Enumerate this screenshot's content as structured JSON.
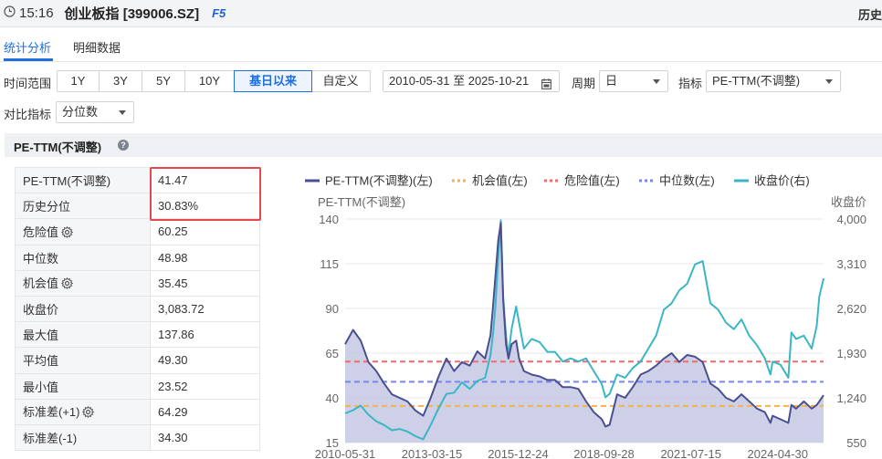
{
  "header": {
    "time": "15:16",
    "title": "创业板指 [399006.SZ]",
    "hotkey": "F5",
    "history_label": "历史"
  },
  "tabs": [
    {
      "label": "统计分析",
      "active": true
    },
    {
      "label": "明细数据",
      "active": false
    }
  ],
  "filters": {
    "range_label": "时间范围",
    "range_options": [
      "1Y",
      "3Y",
      "5Y",
      "10Y",
      "基日以来",
      "自定义"
    ],
    "range_selected": "基日以来",
    "date_range": "2010-05-31 至 2025-10-21",
    "period_label": "周期",
    "period_value": "日",
    "indicator_label": "指标",
    "indicator_value": "PE-TTM(不调整)",
    "compare_label": "对比指标",
    "compare_value": "分位数"
  },
  "section": {
    "title": "PE-TTM(不调整)"
  },
  "stats": [
    {
      "label": "PE-TTM(不调整)",
      "value": "41.47",
      "gear": false
    },
    {
      "label": "历史分位",
      "value": "30.83%",
      "gear": false
    },
    {
      "label": "危险值",
      "value": "60.25",
      "gear": true
    },
    {
      "label": "中位数",
      "value": "48.98",
      "gear": false
    },
    {
      "label": "机会值",
      "value": "35.45",
      "gear": true
    },
    {
      "label": "收盘价",
      "value": "3,083.72",
      "gear": false
    },
    {
      "label": "最大值",
      "value": "137.86",
      "gear": false
    },
    {
      "label": "平均值",
      "value": "49.30",
      "gear": false
    },
    {
      "label": "最小值",
      "value": "23.52",
      "gear": false
    },
    {
      "label": "标准差(+1)",
      "value": "64.29",
      "gear": true
    },
    {
      "label": "标准差(-1)",
      "value": "34.30",
      "gear": false
    }
  ],
  "colors": {
    "accent": "#1f6fe0",
    "pe_line": "#4a4f8f",
    "pe_fill": "#c5c8e4",
    "close_line": "#3bb6c6",
    "opportunity": "#f5b14a",
    "danger": "#f06b6b",
    "median": "#7a86f0",
    "highlight_box": "#e5484d"
  },
  "chart_data": {
    "type": "line",
    "legend": [
      {
        "name": "PE-TTM(不调整)(左)",
        "style": "solid",
        "color": "#4a4f8f"
      },
      {
        "name": "机会值(左)",
        "style": "dotted",
        "color": "#f5b14a"
      },
      {
        "name": "危险值(左)",
        "style": "dotted",
        "color": "#f06b6b"
      },
      {
        "name": "中位数(左)",
        "style": "dotted",
        "color": "#7a86f0"
      },
      {
        "name": "收盘价(右)",
        "style": "solid",
        "color": "#3bb6c6"
      }
    ],
    "ylabel_left": "PE-TTM(不调整)",
    "ylabel_right": "收盘价",
    "y_left_ticks": [
      15,
      40,
      65,
      90,
      115,
      140
    ],
    "y_left_tick_labels": [
      "15",
      "40",
      "65",
      "90",
      "115",
      "140"
    ],
    "y_right_ticks": [
      550,
      1240,
      1930,
      2620,
      3310,
      4000
    ],
    "y_right_tick_labels": [
      "550",
      "1,240",
      "1,930",
      "2,620",
      "3,310",
      "4,000"
    ],
    "ylim_left": [
      15,
      140
    ],
    "ylim_right": [
      550,
      4000
    ],
    "x_tick_labels": [
      "2010-05-31",
      "2013-03-15",
      "2015-12-24",
      "2018-09-28",
      "2021-07-15",
      "2024-04-30"
    ],
    "xlim": [
      "2010-05-31",
      "2025-10-21"
    ],
    "reference_lines": {
      "danger": 60.25,
      "median": 48.98,
      "opportunity": 35.45
    },
    "series": [
      {
        "name": "PE-TTM(不调整)(左)",
        "axis": "left",
        "x": [
          "2010-05-31",
          "2010-09-01",
          "2010-12-01",
          "2011-03-01",
          "2011-06-01",
          "2011-09-01",
          "2011-12-01",
          "2012-03-01",
          "2012-06-01",
          "2012-09-01",
          "2012-12-03",
          "2013-03-01",
          "2013-06-03",
          "2013-09-02",
          "2013-12-02",
          "2014-03-03",
          "2014-06-03",
          "2014-09-01",
          "2014-12-01",
          "2015-02-02",
          "2015-03-02",
          "2015-04-01",
          "2015-05-04",
          "2015-06-03",
          "2015-07-01",
          "2015-08-03",
          "2015-09-01",
          "2015-10-08",
          "2015-12-01",
          "2016-01-04",
          "2016-03-01",
          "2016-06-01",
          "2016-09-01",
          "2016-12-01",
          "2017-03-01",
          "2017-06-01",
          "2017-09-01",
          "2017-12-01",
          "2018-03-01",
          "2018-06-01",
          "2018-09-03",
          "2018-10-15",
          "2018-12-03",
          "2019-03-01",
          "2019-06-03",
          "2019-09-02",
          "2019-12-02",
          "2020-03-02",
          "2020-06-01",
          "2020-09-01",
          "2020-12-01",
          "2021-03-01",
          "2021-06-01",
          "2021-09-01",
          "2021-12-01",
          "2022-03-01",
          "2022-06-01",
          "2022-09-01",
          "2022-12-01",
          "2023-03-01",
          "2023-06-01",
          "2023-09-01",
          "2023-12-01",
          "2024-02-05",
          "2024-03-01",
          "2024-06-03",
          "2024-09-02",
          "2024-10-08",
          "2024-12-02",
          "2025-03-03",
          "2025-06-03",
          "2025-08-01",
          "2025-09-01",
          "2025-10-21"
        ],
        "values": [
          70,
          78,
          72,
          60,
          55,
          48,
          42,
          40,
          38,
          33,
          30,
          40,
          52,
          62,
          55,
          60,
          58,
          66,
          62,
          75,
          90,
          108,
          128,
          137.86,
          95,
          70,
          62,
          70,
          72,
          62,
          55,
          53,
          52,
          50,
          50,
          46,
          46,
          45,
          38,
          32,
          28,
          24,
          25,
          42,
          40,
          46,
          53,
          55,
          58,
          62,
          65,
          60,
          64,
          63,
          60,
          48,
          45,
          40,
          38,
          42,
          38,
          34,
          32,
          26,
          30,
          28,
          26,
          36,
          34,
          38,
          34,
          36,
          38,
          41.47
        ]
      },
      {
        "name": "收盘价(右)",
        "axis": "right",
        "x": [
          "2010-05-31",
          "2010-09-01",
          "2010-12-01",
          "2011-03-01",
          "2011-06-01",
          "2011-09-01",
          "2011-12-01",
          "2012-03-01",
          "2012-06-01",
          "2012-09-01",
          "2012-12-03",
          "2013-03-01",
          "2013-06-03",
          "2013-09-02",
          "2013-12-02",
          "2014-03-03",
          "2014-06-03",
          "2014-09-01",
          "2014-12-01",
          "2015-02-02",
          "2015-03-02",
          "2015-04-01",
          "2015-05-04",
          "2015-06-03",
          "2015-07-01",
          "2015-08-03",
          "2015-09-01",
          "2015-10-08",
          "2015-12-01",
          "2016-01-04",
          "2016-03-01",
          "2016-06-01",
          "2016-09-01",
          "2016-12-01",
          "2017-03-01",
          "2017-06-01",
          "2017-09-01",
          "2017-12-01",
          "2018-03-01",
          "2018-06-01",
          "2018-09-03",
          "2018-10-15",
          "2018-12-03",
          "2019-03-01",
          "2019-06-03",
          "2019-09-02",
          "2019-12-02",
          "2020-03-02",
          "2020-06-01",
          "2020-09-01",
          "2020-12-01",
          "2021-03-01",
          "2021-06-01",
          "2021-09-01",
          "2021-12-01",
          "2022-03-01",
          "2022-06-01",
          "2022-09-01",
          "2022-12-01",
          "2023-03-01",
          "2023-06-01",
          "2023-09-01",
          "2023-12-01",
          "2024-02-05",
          "2024-03-01",
          "2024-06-03",
          "2024-09-02",
          "2024-10-08",
          "2024-12-02",
          "2025-03-03",
          "2025-06-03",
          "2025-08-01",
          "2025-09-01",
          "2025-10-21"
        ],
        "values": [
          1000,
          1050,
          1120,
          980,
          880,
          820,
          740,
          760,
          720,
          650,
          600,
          820,
          1080,
          1300,
          1320,
          1480,
          1380,
          1500,
          1550,
          1900,
          2200,
          2650,
          3400,
          3980,
          2800,
          2200,
          1900,
          2300,
          2650,
          2400,
          2000,
          2150,
          2100,
          1950,
          1950,
          1800,
          1850,
          1800,
          1850,
          1650,
          1450,
          1250,
          1300,
          1600,
          1550,
          1700,
          1800,
          2000,
          2200,
          2600,
          2700,
          2900,
          3000,
          3300,
          3350,
          2700,
          2600,
          2400,
          2300,
          2450,
          2200,
          2050,
          1850,
          1600,
          1800,
          1750,
          1550,
          2250,
          2150,
          2200,
          2000,
          2350,
          2800,
          3083.72
        ]
      }
    ]
  }
}
